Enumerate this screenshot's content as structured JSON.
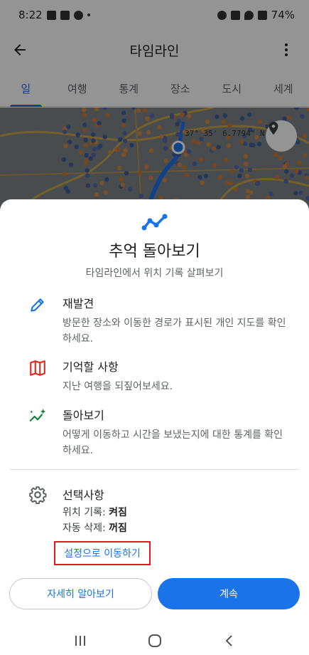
{
  "status_bar": {
    "time": "8:22",
    "battery": "74%"
  },
  "app_bar": {
    "title": "타임라인"
  },
  "tabs": [
    {
      "label": "일",
      "active": true
    },
    {
      "label": "여행",
      "active": false
    },
    {
      "label": "통계",
      "active": false
    },
    {
      "label": "장소",
      "active": false
    },
    {
      "label": "도시",
      "active": false
    },
    {
      "label": "세계",
      "active": false
    }
  ],
  "map": {
    "coordinate_text": "37° 35' 6.7794\" N"
  },
  "sheet": {
    "title": "추억 돌아보기",
    "subtitle": "타임라인에서 위치 기록 살펴보기",
    "features": [
      {
        "icon": "pencil-icon",
        "title": "재발견",
        "desc": "방문한 장소와 이동한 경로가 표시된 개인 지도를 확인하세요."
      },
      {
        "icon": "map-icon",
        "title": "기억할 사항",
        "desc": "지난 여행을 되짚어보세요."
      },
      {
        "icon": "sparkle-trend-icon",
        "title": "돌아보기",
        "desc": "어떻게 이동하고 시간을 보냈는지에 대한 통계를 확인하세요."
      }
    ],
    "options": {
      "title": "선택사항",
      "location_history_label": "위치 기록:",
      "location_history_value": "켜짐",
      "auto_delete_label": "자동 삭제:",
      "auto_delete_value": "꺼짐",
      "settings_link": "설정으로 이동하기"
    },
    "learn_more_button": "자세히 알아보기",
    "continue_button": "계속"
  },
  "colors": {
    "accent": "#1a73e8",
    "highlight_box": "#e0191e"
  }
}
